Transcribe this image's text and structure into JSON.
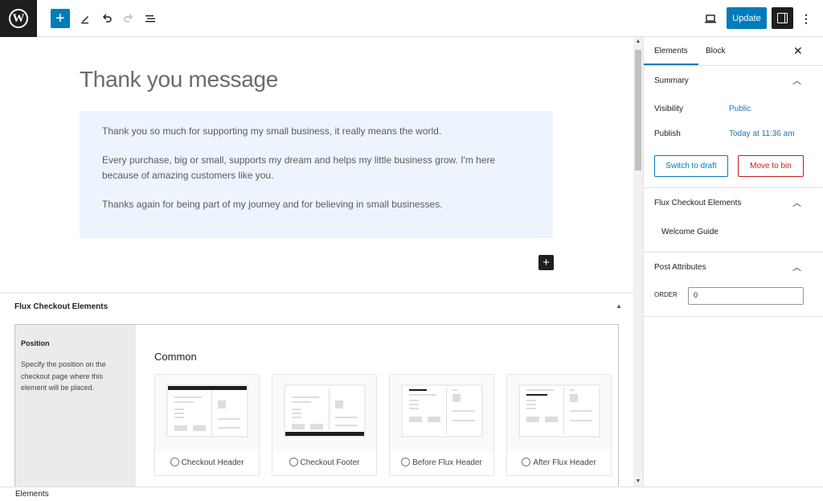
{
  "toolbar": {
    "add_icon": "plus-icon",
    "update_label": "Update"
  },
  "editor": {
    "title": "Thank you message",
    "paragraphs": [
      "Thank you so much for supporting my small business, it really means the world.",
      "Every purchase, big or small, supports my dream and helps my little business grow. I'm here because of amazing customers like you.",
      "Thanks again for being part of my journey and for believing in small businesses."
    ],
    "block_bg": "#eef4fd"
  },
  "metabox": {
    "title": "Flux Checkout Elements",
    "side_heading": "Position",
    "side_desc": "Specify the position on the checkout page where this element will be placed.",
    "group_label": "Common",
    "options": [
      "Checkout Header",
      "Checkout Footer",
      "Before Flux Header",
      "After Flux Header"
    ]
  },
  "sidebar": {
    "tabs": [
      "Elements",
      "Block"
    ],
    "summary": {
      "heading": "Summary",
      "visibility_label": "Visibility",
      "visibility_value": "Public",
      "publish_label": "Publish",
      "publish_value": "Today at 11:36 am",
      "switch_draft": "Switch to draft",
      "move_bin": "Move to bin"
    },
    "flux": {
      "heading": "Flux Checkout Elements",
      "link": "Welcome Guide"
    },
    "post_attributes": {
      "heading": "Post Attributes",
      "order_label": "ORDER",
      "order_value": "0"
    }
  },
  "footer": {
    "breadcrumb": "Elements"
  },
  "colors": {
    "accent": "#007cba",
    "danger": "#cc1818",
    "dark": "#1e1e1e"
  }
}
